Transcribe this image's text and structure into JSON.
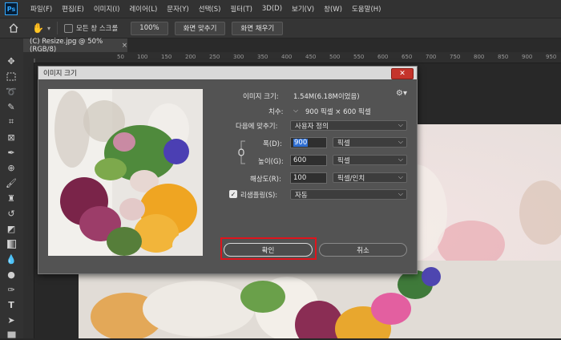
{
  "app": {
    "logo": "Ps"
  },
  "menu": [
    "파일(F)",
    "편집(E)",
    "이미지(I)",
    "레이어(L)",
    "문자(Y)",
    "선택(S)",
    "필터(T)",
    "3D(D)",
    "보기(V)",
    "창(W)",
    "도움말(H)"
  ],
  "options_bar": {
    "scroll_all_label": "모든 창 스크롤",
    "zoom_100": "100%",
    "fit_screen": "화면 맞추기",
    "fill_screen": "화면 채우기"
  },
  "document_tab": {
    "title": "(C) Resize.jpg @ 50% (RGB/8)",
    "close": "×"
  },
  "ruler_ticks": [
    "50",
    "100",
    "150",
    "200",
    "250",
    "300",
    "350",
    "400",
    "450",
    "500",
    "550",
    "600",
    "650",
    "700",
    "750",
    "800",
    "850",
    "900",
    "950"
  ],
  "dialog": {
    "title": "이미지 크기",
    "close": "✕",
    "image_size_label": "이미지 크기:",
    "image_size_value": "1.54M(6.18M이었음)",
    "dimensions_label": "치수:",
    "dimensions_value": "900 픽셀 × 600 픽셀",
    "fit_to_label": "다음에 맞추기:",
    "fit_to_value": "사용자 정의",
    "width_label": "폭(D):",
    "width_value": "900",
    "width_unit": "픽셀",
    "height_label": "높이(G):",
    "height_value": "600",
    "height_unit": "픽셀",
    "resolution_label": "해상도(R):",
    "resolution_value": "100",
    "resolution_unit": "픽셀/인치",
    "resample_label": "리샘플링(S):",
    "resample_value": "자동",
    "ok_label": "확인",
    "cancel_label": "취소"
  },
  "colors": {
    "highlight_box": "#e0141c",
    "close_button": "#c5342b",
    "selection": "#2f6fd3"
  }
}
